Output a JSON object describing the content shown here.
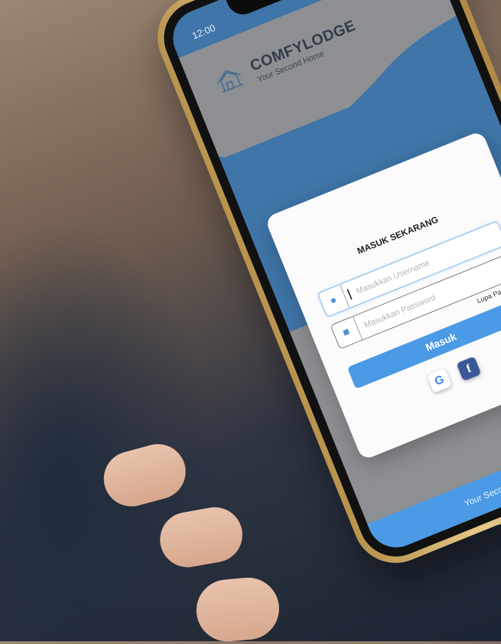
{
  "status": {
    "time": "12:00",
    "icons": "▲▼▮"
  },
  "brand": {
    "name": "COMFYLODGE",
    "tagline": "Your Second Home"
  },
  "login": {
    "title": "MASUK SEKARANG",
    "username_placeholder": "Masukkan Username",
    "password_placeholder": "Masukkan Password",
    "forgot": "Lupa Password",
    "submit": "Masuk"
  },
  "social": {
    "google": "G",
    "facebook": "f"
  },
  "footer": {
    "text": "Your Second Home"
  },
  "colors": {
    "primary": "#3f75a8",
    "accent": "#4b9ae6",
    "gray": "#8d8f92"
  }
}
